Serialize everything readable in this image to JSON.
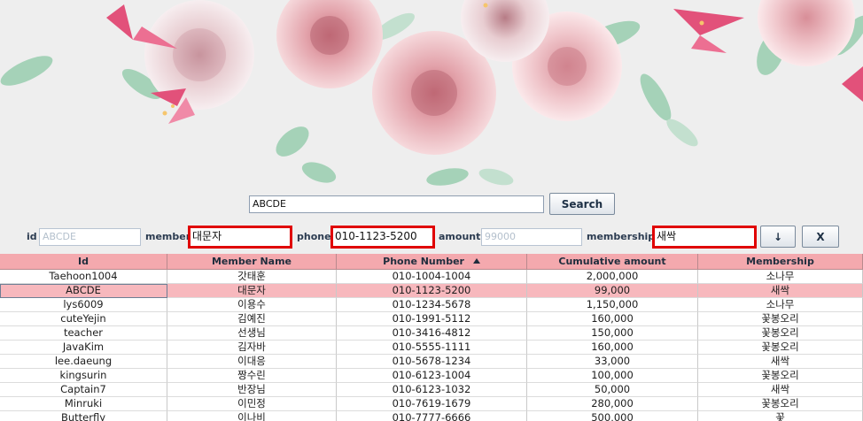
{
  "banner": {
    "image": "pink-roses-and-lilies-floral-banner"
  },
  "search": {
    "query": "ABCDE",
    "button_label": "Search"
  },
  "form": {
    "id_label": "id",
    "id_placeholder": "ABCDE",
    "member_label": "member",
    "member_value": "대문자",
    "phone_label": "phone",
    "phone_value": "010-1123-5200",
    "amount_label": "amount",
    "amount_placeholder": "99000",
    "membership_label": "membership",
    "membership_value": "새싹",
    "down_button": "↓",
    "clear_button": "X"
  },
  "table": {
    "columns": [
      "Id",
      "Member Name",
      "Phone Number",
      "Cumulative amount",
      "Membership"
    ],
    "sort_column_index": 2,
    "sort_icon": "sort-ascending-icon",
    "selected_row_index": 1,
    "rows": [
      [
        "Taehoon1004",
        "갓태훈",
        "010-1004-1004",
        "2,000,000",
        "소나무"
      ],
      [
        "ABCDE",
        "대문자",
        "010-1123-5200",
        "99,000",
        "새싹"
      ],
      [
        "lys6009",
        "이용수",
        "010-1234-5678",
        "1,150,000",
        "소나무"
      ],
      [
        "cuteYejin",
        "김예진",
        "010-1991-5112",
        "160,000",
        "꽃봉오리"
      ],
      [
        "teacher",
        "선생님",
        "010-3416-4812",
        "150,000",
        "꽃봉오리"
      ],
      [
        "JavaKim",
        "김자바",
        "010-5555-1111",
        "160,000",
        "꽃봉오리"
      ],
      [
        "lee.daeung",
        "이대응",
        "010-5678-1234",
        "33,000",
        "새싹"
      ],
      [
        "kingsurin",
        "짱수린",
        "010-6123-1004",
        "100,000",
        "꽃봉오리"
      ],
      [
        "Captain7",
        "반장님",
        "010-6123-1032",
        "50,000",
        "새싹"
      ],
      [
        "Minruki",
        "이민정",
        "010-7619-1679",
        "280,000",
        "꽃봉오리"
      ],
      [
        "Butterfly",
        "이나비",
        "010-7777-6666",
        "500,000",
        "꽃"
      ]
    ]
  },
  "colors": {
    "header_bg": "#f4a9ae",
    "selected_row_bg": "#f7b8bd",
    "highlight_border": "#e00000"
  }
}
